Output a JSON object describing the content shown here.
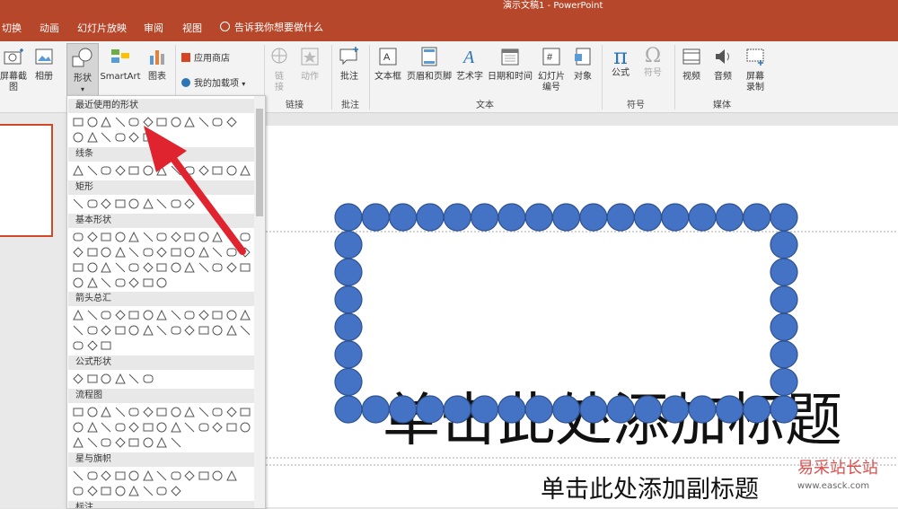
{
  "window": {
    "title": "演示文稿1 - PowerPoint"
  },
  "colors": {
    "accent": "#b7472a",
    "circle_fill": "#4472c4",
    "circle_stroke": "#2f528f",
    "arrow": "#e0242f"
  },
  "tabs": [
    "切换",
    "动画",
    "幻灯片放映",
    "审阅",
    "视图"
  ],
  "tellme": "告诉我你想要做什么",
  "ribbon": {
    "screenshot": "屏幕截图",
    "album": "相册",
    "shapes": "形状",
    "smartart": "SmartArt",
    "chart": "图表",
    "store": "应用商店",
    "addins": "我的加载项",
    "link": "链接",
    "action": "动作",
    "comment": "批注",
    "textbox": "文本框",
    "header_footer": "页眉和页脚",
    "wordart": "艺术字",
    "datetime": "日期和时间",
    "slide_number": "幻灯片编号",
    "object": "对象",
    "equation": "公式",
    "symbol": "符号",
    "video": "视频",
    "audio": "音频",
    "screen_record": "屏幕录制",
    "groups": {
      "links": "链接",
      "comments": "批注",
      "text": "文本",
      "symbols": "符号",
      "media": "媒体"
    }
  },
  "gallery": {
    "categories": [
      "最近使用的形状",
      "线条",
      "矩形",
      "基本形状",
      "箭头总汇",
      "公式形状",
      "流程图",
      "星与旗帜",
      "标注"
    ]
  },
  "slide": {
    "title_placeholder": "单击此处添加标题",
    "subtitle_placeholder": "单击此处添加副标题"
  },
  "watermark": {
    "line1": "易采站长站",
    "line2": "www.easck.com"
  }
}
